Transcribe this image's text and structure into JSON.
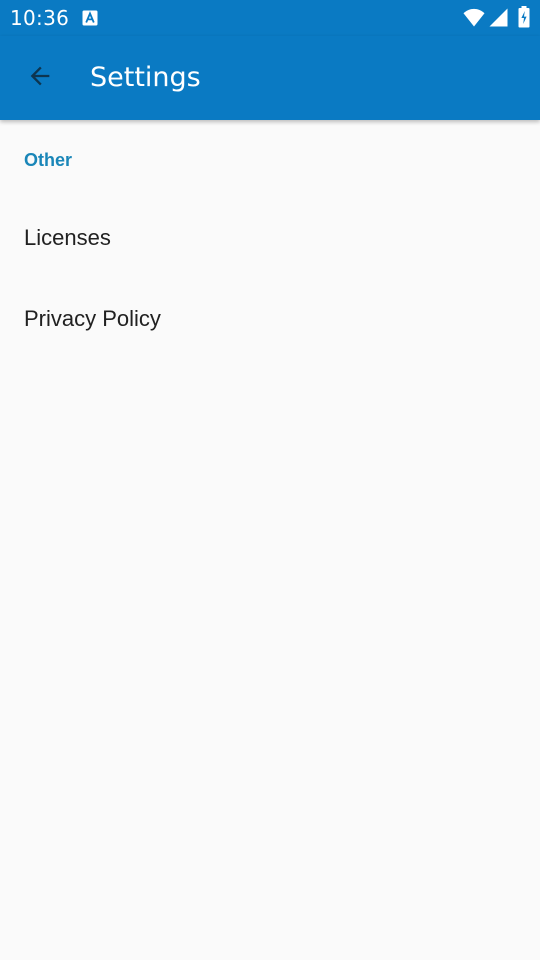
{
  "status_bar": {
    "time": "10:36",
    "background": "#0a7ac3",
    "icons": [
      "notification-a-icon",
      "wifi-icon",
      "signal-icon",
      "battery-charging-icon"
    ]
  },
  "app_bar": {
    "title": "Settings",
    "background": "#0a7ac3",
    "back_icon": "arrow-back-icon"
  },
  "preferences": {
    "category": {
      "title": "Other",
      "color": "#1a86b8"
    },
    "items": [
      {
        "label": "Licenses"
      },
      {
        "label": "Privacy Policy"
      }
    ]
  }
}
